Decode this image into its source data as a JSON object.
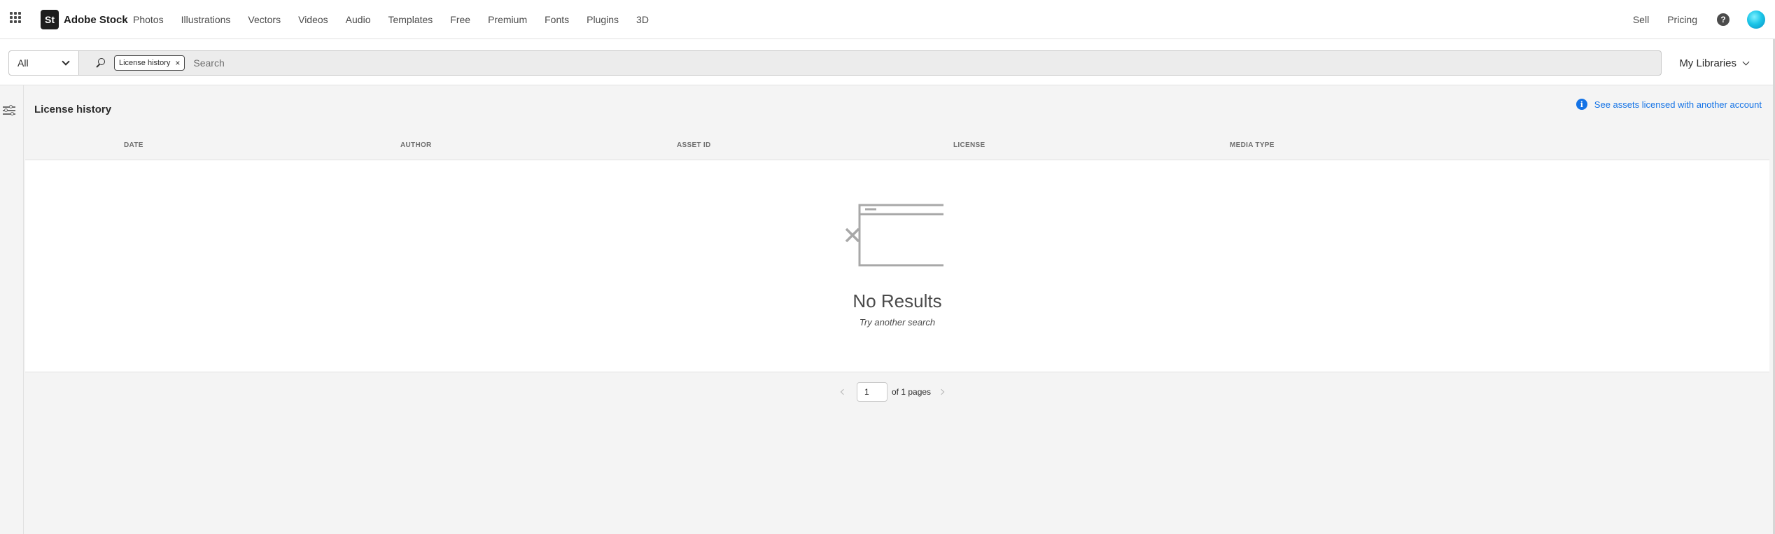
{
  "brand": {
    "logo_text": "St",
    "name": "Adobe Stock"
  },
  "nav": {
    "links": [
      "Photos",
      "Illustrations",
      "Vectors",
      "Videos",
      "Audio",
      "Templates",
      "Free",
      "Premium",
      "Fonts",
      "Plugins",
      "3D"
    ],
    "sell": "Sell",
    "pricing": "Pricing",
    "help_glyph": "?"
  },
  "search": {
    "scope": "All",
    "chip_label": "License history",
    "chip_close": "×",
    "placeholder": "Search",
    "value": ""
  },
  "libraries_label": "My Libraries",
  "page": {
    "title": "License history",
    "info_glyph": "i",
    "info_link": "See assets licensed with another account"
  },
  "table": {
    "columns": [
      "DATE",
      "AUTHOR",
      "ASSET ID",
      "LICENSE",
      "MEDIA TYPE"
    ]
  },
  "empty_state": {
    "title": "No Results",
    "subtitle": "Try another search"
  },
  "pagination": {
    "current_page": "1",
    "total_text": "of 1 pages"
  },
  "colors": {
    "link": "#1473e6",
    "text": "#2c2c2c",
    "background": "#f4f4f4"
  },
  "icons": {
    "apps": "apps-grid-icon",
    "search": "search-icon",
    "help": "help-icon",
    "filter": "filter-icon",
    "info": "info-icon",
    "empty": "empty-window-x-icon"
  }
}
